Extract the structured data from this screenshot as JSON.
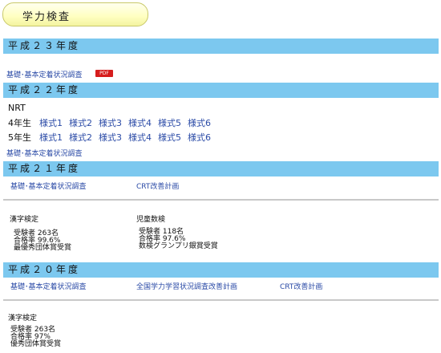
{
  "page_title": "学力検査",
  "h23": {
    "bar": "平成２３年度",
    "link": "基礎･基本定着状況調査",
    "pdf_badge": "PDF"
  },
  "h22": {
    "bar": "平成２２年度",
    "nrt": "NRT",
    "grade4_label": "4年生",
    "grade5_label": "5年生",
    "styles": [
      "様式1",
      "様式2",
      "様式3",
      "様式4",
      "様式5",
      "様式6"
    ],
    "link": "基礎･基本定着状況調査"
  },
  "h21": {
    "bar": "平成２１年度",
    "link1": "基礎･基本定着状況調査",
    "link2": "CRT改善計画",
    "kanji_title": "漢字検定",
    "kanji_stats": [
      "受験者 263名",
      "合格率 99.6%",
      "最優秀団体賞受賞"
    ],
    "math_title": "児童数検",
    "math_stats": [
      "受験者 118名",
      "合格率 97.6%",
      "数検グランプリ銀賞受賞"
    ]
  },
  "h20": {
    "bar": "平成２０年度",
    "link1": "基礎･基本定着状況調査",
    "link2": "全国学力学習状況調査改善計画",
    "link3": "CRT改善計画",
    "kanji_title": "漢字検定",
    "kanji_stats": [
      "受験者 263名",
      "合格率 97%",
      "優秀団体賞受賞"
    ]
  }
}
